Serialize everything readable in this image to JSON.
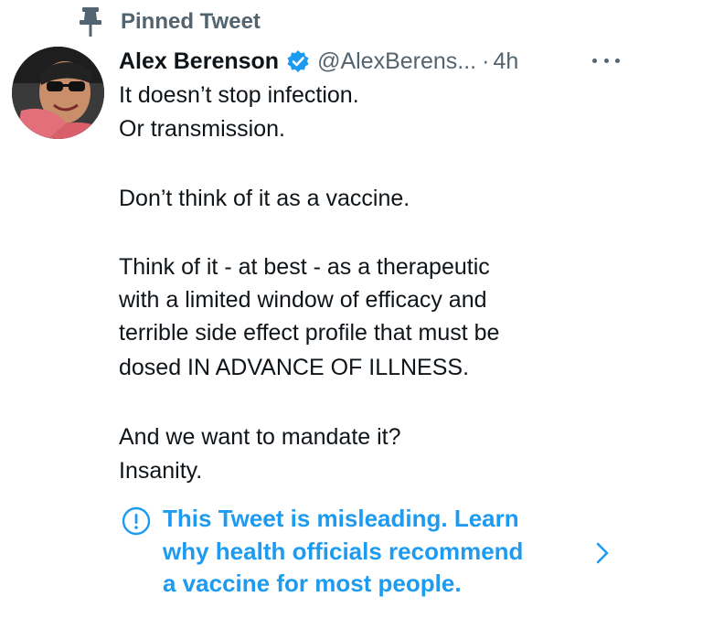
{
  "pinned": {
    "label": "Pinned Tweet",
    "icon": "pin-icon"
  },
  "author": {
    "name": "Alex Berenson",
    "handle": "@AlexBerens...",
    "separator": "·",
    "timestamp": "4h",
    "verified": true,
    "avatar_icon": "avatar-photo"
  },
  "tweet": {
    "lines": [
      "It doesn’t stop infection.",
      "Or transmission.",
      "",
      "Don’t think of it as a vaccine.",
      "",
      "Think of it - at best - as a therapeutic",
      "with a limited window of efficacy and",
      "terrible side effect profile that must be",
      "dosed IN ADVANCE OF ILLNESS.",
      "",
      "And we want to mandate it?",
      "Insanity."
    ]
  },
  "notice": {
    "lines": [
      "This Tweet is misleading. Learn",
      "why health officials recommend",
      "a vaccine for most people."
    ],
    "icon": "exclamation-circle-icon",
    "chevron_icon": "chevron-right-icon"
  },
  "colors": {
    "text_primary": "#0f1419",
    "text_secondary": "#536471",
    "link_blue": "#1d9bf0",
    "verified_blue": "#1d9bf0",
    "background": "#ffffff"
  }
}
